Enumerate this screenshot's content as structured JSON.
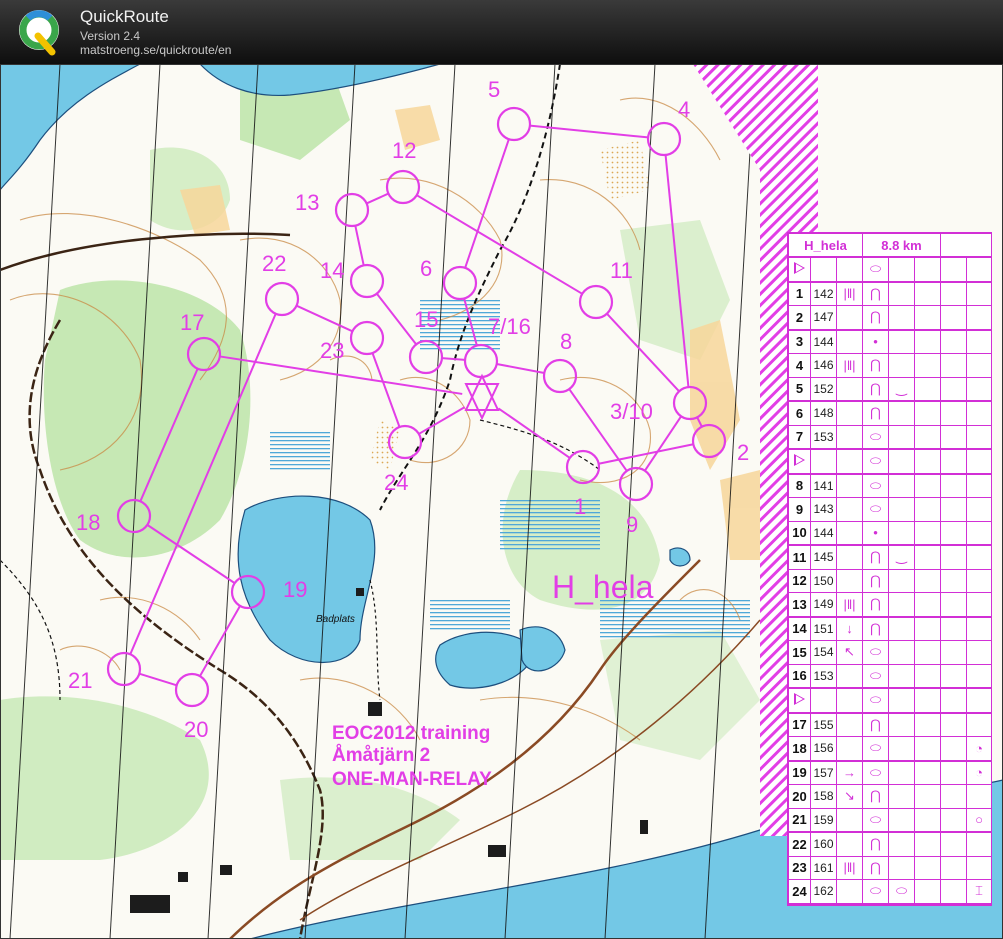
{
  "app": {
    "title": "QuickRoute",
    "version": "Version 2.4",
    "url": "matstroeng.se/quickroute/en"
  },
  "colors": {
    "course": "#e23ee6",
    "water": "#73c8e6",
    "forest_green": "#c6e8b4",
    "open_yellow": "#f7d69a",
    "contour": "#c98a45",
    "road": "#4a2c14"
  },
  "map": {
    "course_name": "H_hela",
    "event_lines": [
      "EOC2012 training",
      "Åmåtjärn 2",
      "ONE-MAN-RELAY"
    ],
    "place_label": "Badplats"
  },
  "controls": [
    {
      "label": "1"
    },
    {
      "label": "2"
    },
    {
      "label": "3/10"
    },
    {
      "label": "4"
    },
    {
      "label": "5"
    },
    {
      "label": "6"
    },
    {
      "label": "7/16"
    },
    {
      "label": "8"
    },
    {
      "label": "9"
    },
    {
      "label": "11"
    },
    {
      "label": "12"
    },
    {
      "label": "13"
    },
    {
      "label": "14"
    },
    {
      "label": "15"
    },
    {
      "label": "17"
    },
    {
      "label": "18"
    },
    {
      "label": "19"
    },
    {
      "label": "20"
    },
    {
      "label": "21"
    },
    {
      "label": "22"
    },
    {
      "label": "23"
    },
    {
      "label": "24"
    }
  ],
  "description_sheet": {
    "header": {
      "course": "H_hela",
      "length": "8.8 km"
    },
    "rows": [
      {
        "type": "start",
        "num": "",
        "code": "",
        "c3": "",
        "c4": "⬭",
        "c5": "",
        "c8": ""
      },
      {
        "type": "control",
        "num": "1",
        "code": "142",
        "c3": "|‖|",
        "c4": "⋂",
        "c5": "",
        "c8": ""
      },
      {
        "type": "control",
        "num": "2",
        "code": "147",
        "c3": "",
        "c4": "⋂",
        "c5": "",
        "c8": ""
      },
      {
        "type": "control",
        "num": "3",
        "code": "144",
        "c3": "",
        "c4": "•",
        "c5": "",
        "c8": ""
      },
      {
        "type": "control",
        "num": "4",
        "code": "146",
        "c3": "|‖|",
        "c4": "⋂",
        "c5": "",
        "c8": ""
      },
      {
        "type": "control",
        "num": "5",
        "code": "152",
        "c3": "",
        "c4": "⋂",
        "c5": "‿",
        "c8": ""
      },
      {
        "type": "control",
        "num": "6",
        "code": "148",
        "c3": "",
        "c4": "⋂",
        "c5": "",
        "c8": ""
      },
      {
        "type": "control",
        "num": "7",
        "code": "153",
        "c3": "",
        "c4": "⬭",
        "c5": "",
        "c8": ""
      },
      {
        "type": "start",
        "num": "",
        "code": "",
        "c3": "",
        "c4": "⬭",
        "c5": "",
        "c8": ""
      },
      {
        "type": "control",
        "num": "8",
        "code": "141",
        "c3": "",
        "c4": "⬭",
        "c5": "",
        "c8": ""
      },
      {
        "type": "control",
        "num": "9",
        "code": "143",
        "c3": "",
        "c4": "⬭",
        "c5": "",
        "c8": ""
      },
      {
        "type": "control",
        "num": "10",
        "code": "144",
        "c3": "",
        "c4": "•",
        "c5": "",
        "c8": ""
      },
      {
        "type": "control",
        "num": "11",
        "code": "145",
        "c3": "",
        "c4": "⋂",
        "c5": "‿",
        "c8": ""
      },
      {
        "type": "control",
        "num": "12",
        "code": "150",
        "c3": "",
        "c4": "⋂",
        "c5": "",
        "c8": ""
      },
      {
        "type": "control",
        "num": "13",
        "code": "149",
        "c3": "|‖|",
        "c4": "⋂",
        "c5": "",
        "c8": ""
      },
      {
        "type": "control",
        "num": "14",
        "code": "151",
        "c3": "↓",
        "c4": "⋂",
        "c5": "",
        "c8": ""
      },
      {
        "type": "control",
        "num": "15",
        "code": "154",
        "c3": "↖",
        "c4": "⬭",
        "c5": "",
        "c8": ""
      },
      {
        "type": "control",
        "num": "16",
        "code": "153",
        "c3": "",
        "c4": "⬭",
        "c5": "",
        "c8": ""
      },
      {
        "type": "start",
        "num": "",
        "code": "",
        "c3": "",
        "c4": "⬭",
        "c5": "",
        "c8": ""
      },
      {
        "type": "control",
        "num": "17",
        "code": "155",
        "c3": "",
        "c4": "⋂",
        "c5": "",
        "c8": ""
      },
      {
        "type": "control",
        "num": "18",
        "code": "156",
        "c3": "",
        "c4": "⬭",
        "c5": "",
        "c8": "◔"
      },
      {
        "type": "control",
        "num": "19",
        "code": "157",
        "c3": "→",
        "c4": "⬭",
        "c5": "",
        "c8": "◔"
      },
      {
        "type": "control",
        "num": "20",
        "code": "158",
        "c3": "↘",
        "c4": "⋂",
        "c5": "",
        "c8": ""
      },
      {
        "type": "control",
        "num": "21",
        "code": "159",
        "c3": "",
        "c4": "⬭",
        "c5": "",
        "c8": "○"
      },
      {
        "type": "control",
        "num": "22",
        "code": "160",
        "c3": "",
        "c4": "⋂",
        "c5": "",
        "c8": ""
      },
      {
        "type": "control",
        "num": "23",
        "code": "161",
        "c3": "|‖|",
        "c4": "⋂",
        "c5": "",
        "c8": ""
      },
      {
        "type": "control",
        "num": "24",
        "code": "162",
        "c3": "",
        "c4": "⬭",
        "c5": "⬭",
        "c8": "⌶"
      }
    ]
  }
}
